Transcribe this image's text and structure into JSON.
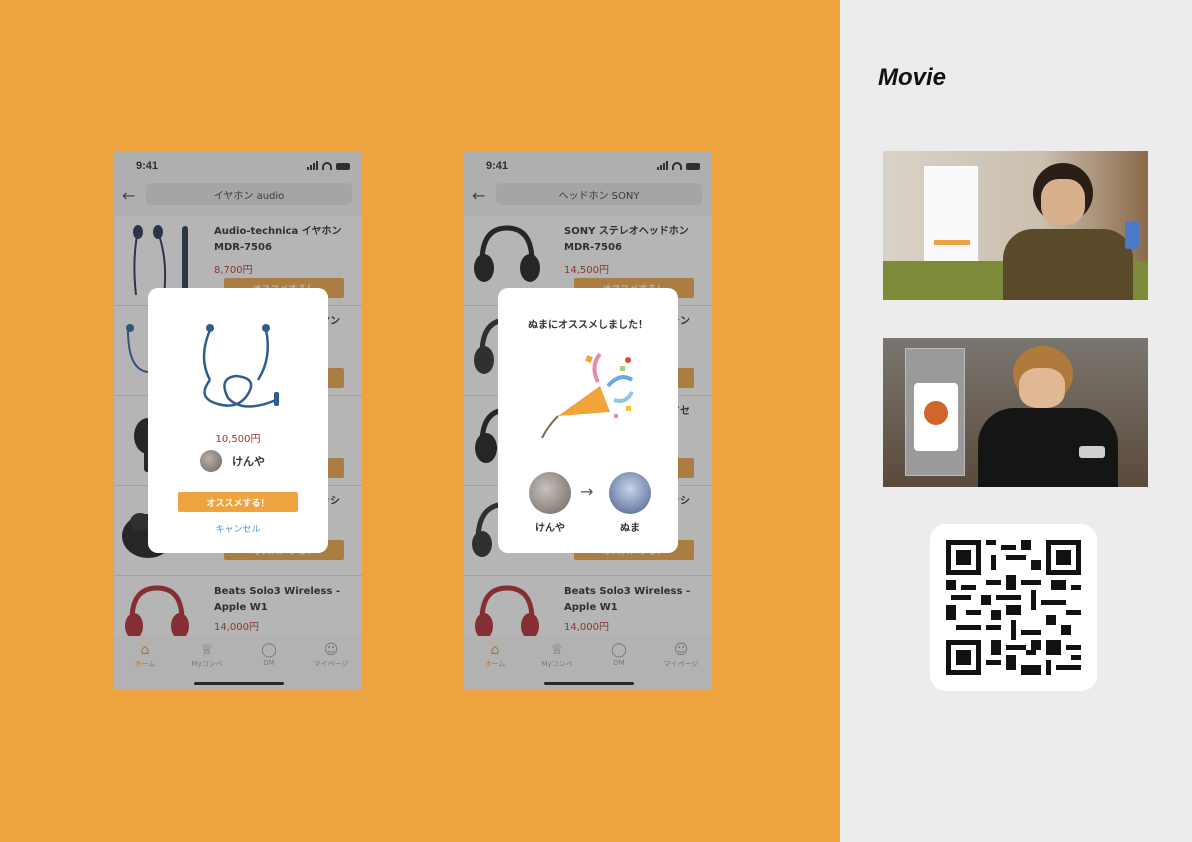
{
  "phone1": {
    "time": "9:41",
    "search": "イヤホン audio",
    "items": [
      {
        "name": "Audio-technica イヤホン MDR-7506",
        "price": "8,700円",
        "button": "オススメする！"
      },
      {
        "name": "ヤン",
        "price": "",
        "button": ""
      },
      {
        "name": "",
        "price": "",
        "button": ""
      },
      {
        "name": "ッシ",
        "price": "",
        "button": "オススメする！"
      },
      {
        "name": "Beats Solo3 Wireless -Apple W1",
        "price": "14,000円",
        "button": ""
      }
    ],
    "modal": {
      "price": "10,500円",
      "user": "けんや",
      "button": "オススメする！",
      "cancel": "キャンセル"
    }
  },
  "phone2": {
    "time": "9:41",
    "search": "ヘッドホン SONY",
    "items": [
      {
        "name": "SONY ステレオヘッドホン MDR-7506",
        "price": "14,500円",
        "button": "オススメする！"
      },
      {
        "name": "ャン",
        "price": "",
        "button": ""
      },
      {
        "name": "ドセ",
        "price": "",
        "button": ""
      },
      {
        "name": "ッシ",
        "price": "",
        "button": "オススメする！"
      },
      {
        "name": "Beats Solo3 Wireless -Apple W1",
        "price": "14,000円",
        "button": ""
      }
    ],
    "modal": {
      "title": "ぬまにオススメしました！",
      "from_user": "けんや",
      "to_user": "ぬま"
    }
  },
  "tabs": [
    "ホーム",
    "Myコンペ",
    "DM",
    "マイページ"
  ],
  "tab_icons": [
    "home-icon",
    "trophy-icon",
    "chat-bubble-icon",
    "person-icon"
  ],
  "movie": {
    "title": "Movie"
  },
  "colors": {
    "accent": "#eda440",
    "price": "#b0302a",
    "link": "#4a9ad8"
  }
}
